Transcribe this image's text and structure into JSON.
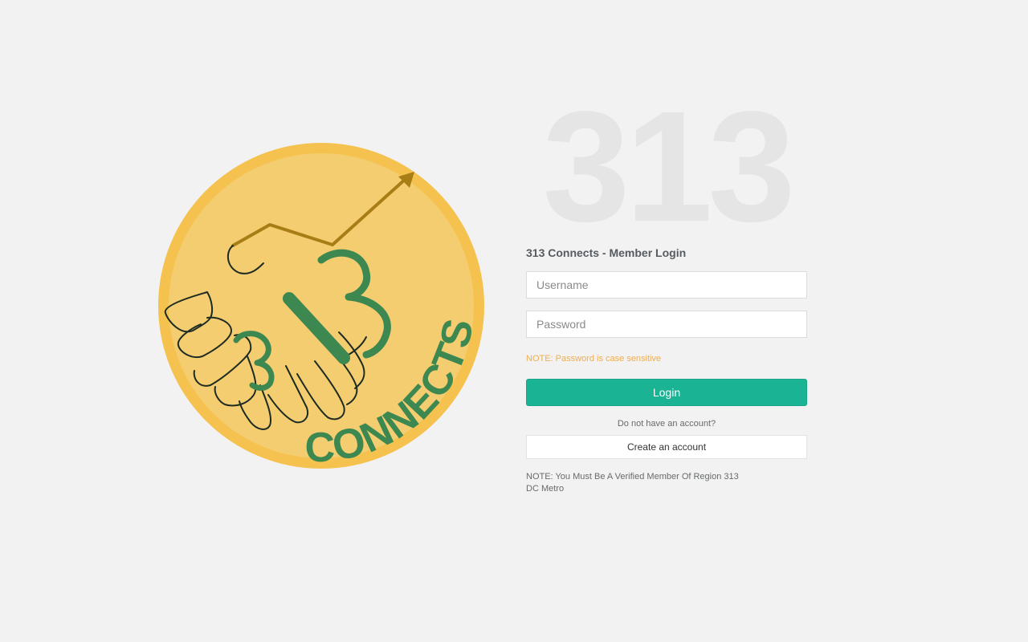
{
  "logo": {
    "icon": "handshake-coin-logo",
    "text": "CONNECTS",
    "colors": {
      "coin_outer": "#f5c24f",
      "coin_inner": "#f3cd70",
      "green": "#3d8750",
      "arrow": "#a87d15",
      "outline": "#1e2b22"
    }
  },
  "big_title": "313",
  "login": {
    "heading": "313 Connects - Member Login",
    "username_placeholder": "Username",
    "password_placeholder": "Password",
    "note_case": "NOTE: Password is case sensitive",
    "login_label": "Login",
    "no_account_text": "Do not have an account?",
    "create_label": "Create an account",
    "member_note": "NOTE: You Must Be A Verified Member Of Region 313 DC Metro"
  },
  "colors": {
    "background": "#f2f2f2",
    "accent": "#1ab394",
    "warning": "#f0ad4e"
  }
}
